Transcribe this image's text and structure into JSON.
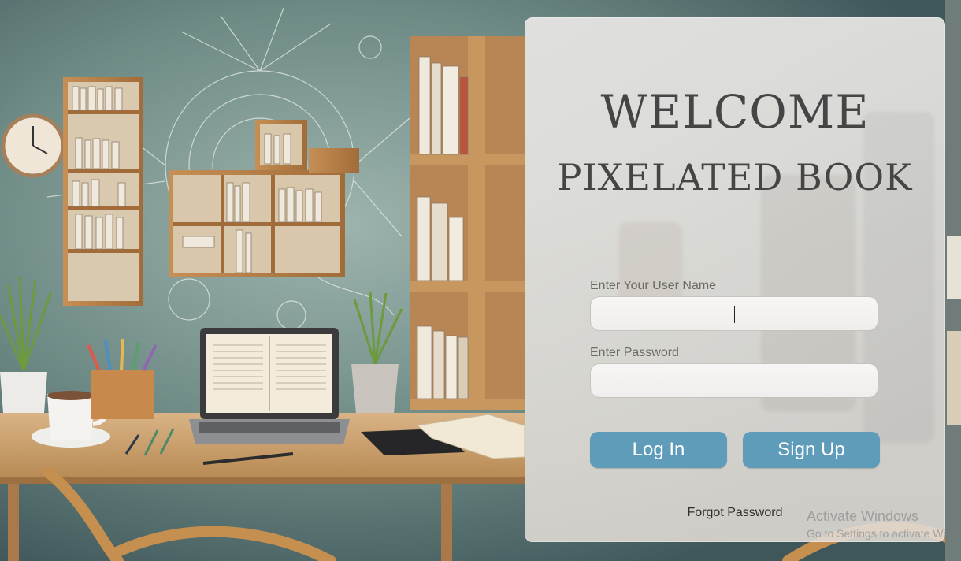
{
  "panel": {
    "welcome": "WELCOME",
    "app_name": "PIXELATED BOOK"
  },
  "form": {
    "username_label": "Enter Your User Name",
    "username_value": "",
    "password_label": "Enter Password",
    "password_value": ""
  },
  "buttons": {
    "login": "Log In",
    "signup": "Sign Up"
  },
  "links": {
    "forgot_password": "Forgot Password"
  },
  "watermark": {
    "title": "Activate Windows",
    "subtitle": "Go to Settings to activate Windows."
  },
  "colors": {
    "button": "#5e9cba",
    "title_text": "#454545",
    "wall": "#5b7773",
    "desk": "#caa172"
  }
}
